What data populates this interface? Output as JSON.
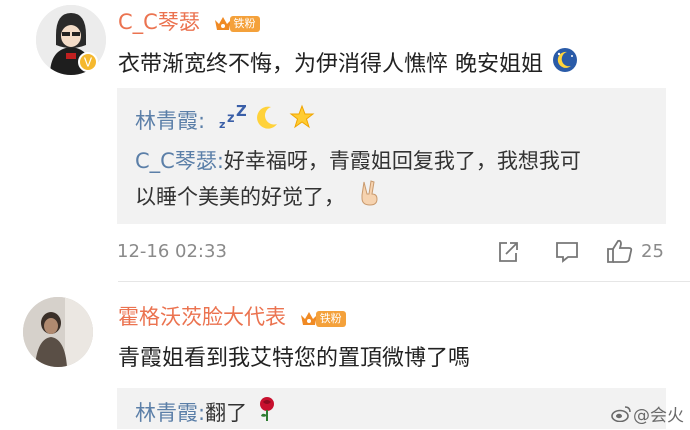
{
  "comments": [
    {
      "username": "C_C琴瑟",
      "badge": "铁粉",
      "text": "衣带渐宽终不悔，为伊消得人憔悴 晚安姐姐",
      "replies": [
        {
          "name": "林青霞",
          "sep": ":",
          "text": "",
          "emojis": [
            "zzz-icon",
            "moon-icon",
            "star-icon"
          ]
        },
        {
          "name": "C_C琴瑟",
          "sep": ":",
          "text": "好幸福呀，青霞姐回复我了，我想我可",
          "text2": "以睡个美美的好觉了，"
        }
      ],
      "timestamp": "12-16 02:33",
      "likes": "25"
    },
    {
      "username": "霍格沃茨脸大代表",
      "badge": "铁粉",
      "text": "青霞姐看到我艾特您的置頂微博了嗎",
      "replies": [
        {
          "name": "林青霞",
          "sep": ":",
          "text": "翻了"
        }
      ]
    }
  ],
  "watermark": "@会火",
  "colors": {
    "username": "#eb7350",
    "reply_name": "#5b7fa8",
    "meta": "#8a8a8a",
    "reply_bg": "#f2f2f2"
  }
}
